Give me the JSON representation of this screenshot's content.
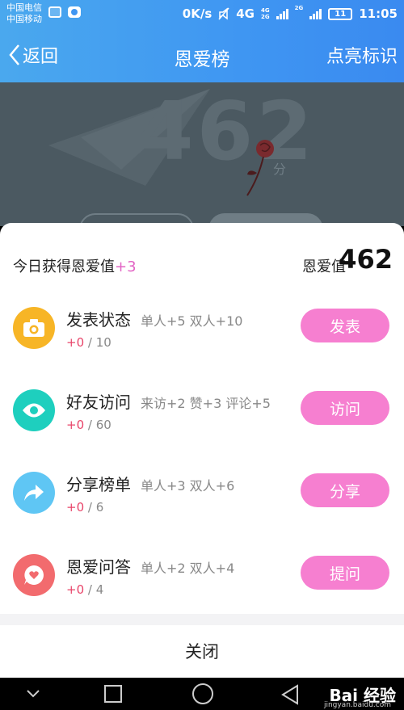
{
  "status_bar": {
    "carrier_1": "中国电信",
    "carrier_2": "中国移动",
    "speed": "0K/s",
    "network": "4G",
    "network_small_1": "4G",
    "network_small_2": "2G",
    "network_small_3": "2G",
    "battery": "11",
    "time": "11:05"
  },
  "header": {
    "back_label": "返回",
    "title": "恩爱榜",
    "action_label": "点亮标识",
    "bg_color": "#3f96f2"
  },
  "score": {
    "value": "462",
    "unit": "分"
  },
  "summary": {
    "today_label": "今日获得恩爱值",
    "today_plus": "+3",
    "total_label": "恩爱值",
    "total_value": "462"
  },
  "tasks": [
    {
      "name": "发表状态",
      "desc": "单人+5 双人+10",
      "current": "+0",
      "limit": " / 10",
      "button": "发表",
      "icon": "camera-icon",
      "color": "#f7b526"
    },
    {
      "name": "好友访问",
      "desc": "来访+2 赞+3 评论+5",
      "current": "+0",
      "limit": " / 60",
      "button": "访问",
      "icon": "eye-icon",
      "color": "#1ecfbe"
    },
    {
      "name": "分享榜单",
      "desc": "单人+3 双人+6",
      "current": "+0",
      "limit": " / 6",
      "button": "分享",
      "icon": "share-icon",
      "color": "#5fc6f4"
    },
    {
      "name": "恩爱问答",
      "desc": "单人+2 双人+4",
      "current": "+0",
      "limit": " / 4",
      "button": "提问",
      "icon": "heart-chat-icon",
      "color": "#f26b6e"
    }
  ],
  "close_label": "关闭",
  "watermark": {
    "text": "Bai 经验",
    "sub": "jingyan.baidu.com"
  },
  "colors": {
    "accent_pink": "#f67fd0",
    "progress_red": "#e8456a"
  }
}
